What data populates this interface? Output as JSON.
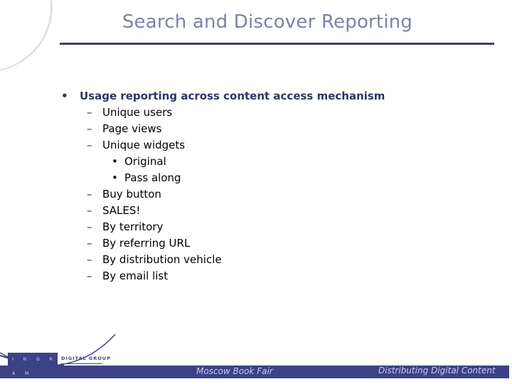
{
  "slide": {
    "title": "Search and Discover Reporting",
    "bullets": {
      "main": "Usage reporting across content access mechanism",
      "bullet_glyph": "•",
      "dash_glyph": "–",
      "sub_dot_glyph": "•",
      "items": [
        {
          "level": 2,
          "text": "Unique users"
        },
        {
          "level": 2,
          "text": "Page views"
        },
        {
          "level": 2,
          "text": "Unique widgets"
        },
        {
          "level": 3,
          "text": "Original"
        },
        {
          "level": 3,
          "text": "Pass along"
        },
        {
          "level": 2,
          "text": "Buy button"
        },
        {
          "level": 2,
          "text": "SALES!"
        },
        {
          "level": 2,
          "text": "By territory"
        },
        {
          "level": 2,
          "text": "By referring URL"
        },
        {
          "level": 2,
          "text": "By distribution vehicle"
        },
        {
          "level": 2,
          "text": "By email list"
        }
      ]
    }
  },
  "footer": {
    "logo_name": "I N G R A M",
    "logo_sub": "DIGITAL GROUP",
    "event": "Moscow Book Fair",
    "tagline": "Distributing Digital Content"
  },
  "colors": {
    "accent": "#3b4288",
    "title": "#7d82a8",
    "rule": "#3e3f66"
  }
}
